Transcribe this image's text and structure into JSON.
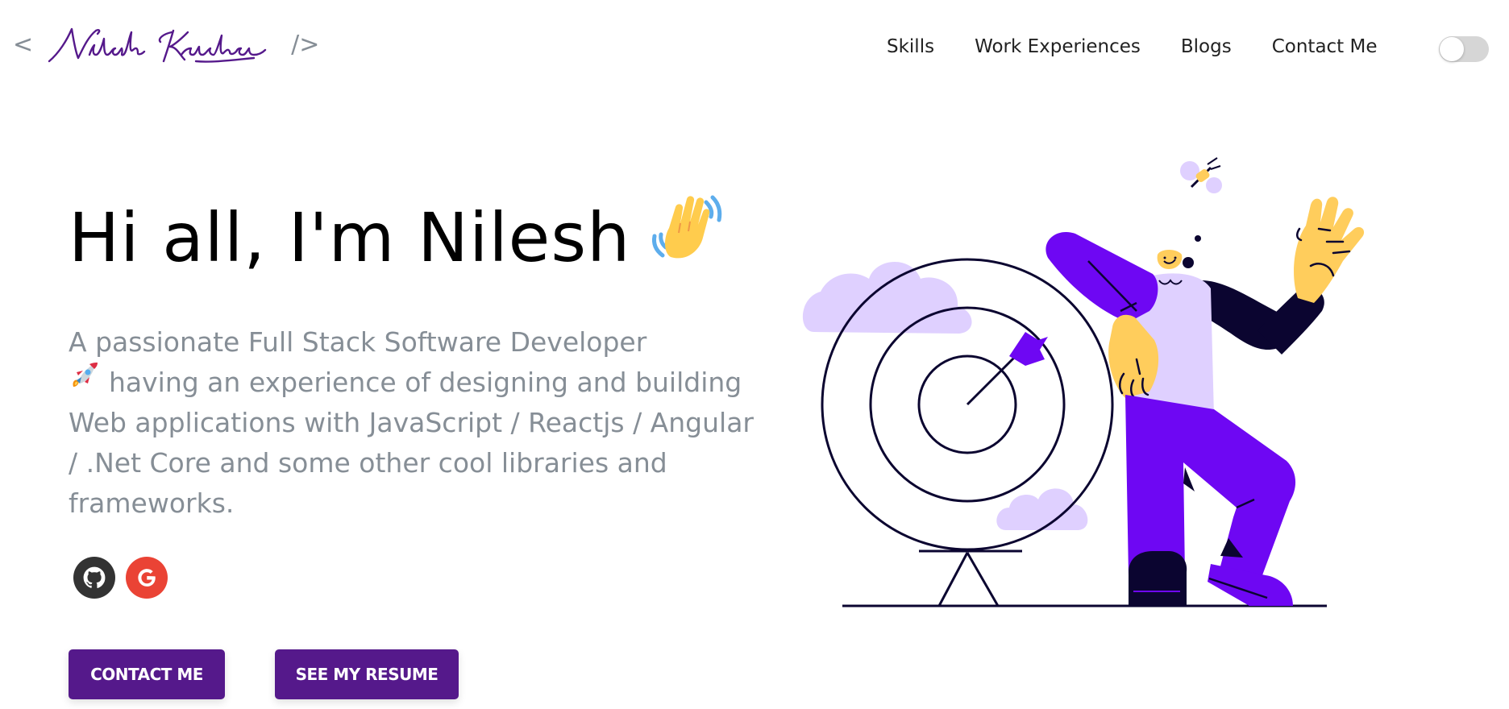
{
  "header": {
    "logo": {
      "open_bracket": "<",
      "signature": "Nilesh Krishna",
      "close_bracket": "/>"
    },
    "nav": [
      {
        "label": "Skills"
      },
      {
        "label": "Work Experiences"
      },
      {
        "label": "Blogs"
      },
      {
        "label": "Contact Me"
      }
    ],
    "theme_toggle": {
      "state": "off"
    }
  },
  "greeting": {
    "title": "Hi all, I'm Nilesh",
    "wave_icon": "waving-hand-emoji",
    "subtitle_prefix": "A passionate Full Stack Software Developer",
    "rocket_icon": "rocket-emoji",
    "subtitle_suffix": "having an experience of designing and building Web applications with JavaScript / Reactjs / Angular / .Net Core and some other cool libraries and frameworks."
  },
  "social": [
    {
      "icon": "github-icon",
      "color": "#333333"
    },
    {
      "icon": "google-icon",
      "color": "#ea4335"
    }
  ],
  "buttons": {
    "contact": "CONTACT ME",
    "resume": "SEE MY RESUME"
  },
  "colors": {
    "accent": "#55198b",
    "text_muted": "#868e96",
    "illustration_purple": "#6e07f3",
    "illustration_lavender": "#dfd0ff",
    "illustration_yellow": "#ffcd5c",
    "illustration_navy": "#0b0530"
  }
}
